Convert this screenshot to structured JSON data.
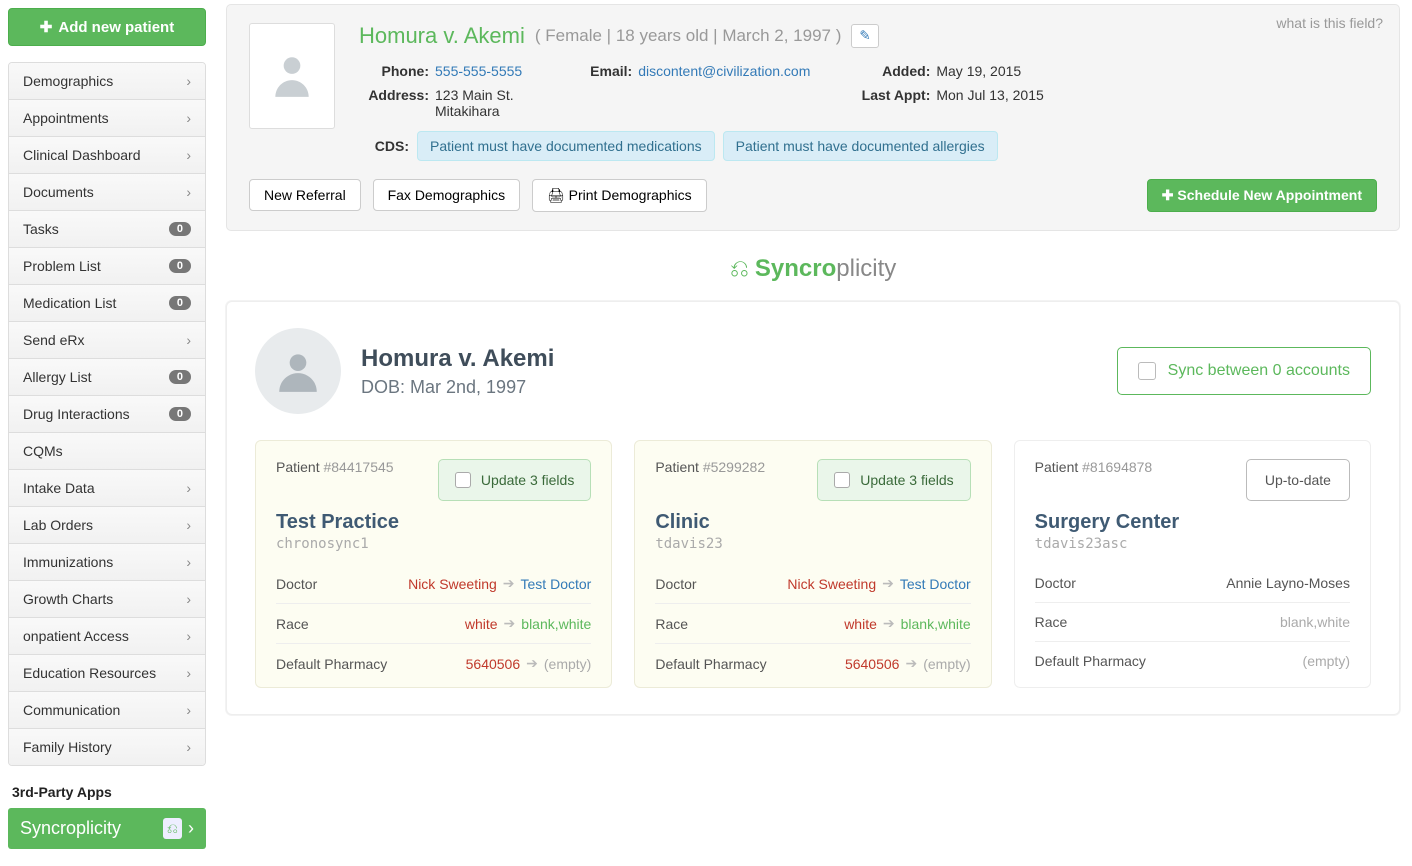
{
  "sidebar": {
    "add_patient": "Add new patient",
    "items": [
      {
        "label": "Demographics",
        "chevron": true
      },
      {
        "label": "Appointments",
        "chevron": true
      },
      {
        "label": "Clinical Dashboard",
        "chevron": true
      },
      {
        "label": "Documents",
        "chevron": true
      },
      {
        "label": "Tasks",
        "badge": "0"
      },
      {
        "label": "Problem List",
        "badge": "0"
      },
      {
        "label": "Medication List",
        "badge": "0"
      },
      {
        "label": "Send eRx",
        "chevron": true
      },
      {
        "label": "Allergy List",
        "badge": "0"
      },
      {
        "label": "Drug Interactions",
        "badge": "0"
      },
      {
        "label": "CQMs"
      },
      {
        "label": "Intake Data",
        "chevron": true
      },
      {
        "label": "Lab Orders",
        "chevron": true
      },
      {
        "label": "Immunizations",
        "chevron": true
      },
      {
        "label": "Growth Charts",
        "chevron": true
      },
      {
        "label": "onpatient Access",
        "chevron": true
      },
      {
        "label": "Education Resources",
        "chevron": true
      },
      {
        "label": "Communication",
        "chevron": true
      },
      {
        "label": "Family History",
        "chevron": true
      }
    ],
    "third_party_header": "3rd-Party Apps",
    "syncroplicity": "Syncroplicity"
  },
  "header": {
    "what_is_this": "what is this field?",
    "name": "Homura v. Akemi",
    "gender": "Female",
    "age": "18 years old",
    "dob": "March 2, 1997",
    "phone_label": "Phone:",
    "phone": "555-555-5555",
    "address_label": "Address:",
    "address_l1": "123 Main St.",
    "address_l2": "Mitakihara",
    "email_label": "Email:",
    "email": "discontent@civilization.com",
    "added_label": "Added:",
    "added": "May 19, 2015",
    "last_appt_label": "Last Appt:",
    "last_appt": "Mon Jul 13, 2015",
    "cds_label": "CDS:",
    "cds_tags": [
      "Patient must have documented medications",
      "Patient must have documented allergies"
    ],
    "btn_new_referral": "New Referral",
    "btn_fax": "Fax Demographics",
    "btn_print": "Print Demographics",
    "btn_schedule": "Schedule New Appointment"
  },
  "syncro": {
    "brand_a": "Syncro",
    "brand_b": "plicity",
    "name": "Homura v. Akemi",
    "dob_label": "DOB: Mar 2nd, 1997",
    "sync_between": "Sync between 0 accounts",
    "patient_label": "Patient",
    "update_label": "Update 3 fields",
    "uptodate_label": "Up-to-date",
    "cards": [
      {
        "id": "#84417545",
        "practice": "Test Practice",
        "user": "chronosync1",
        "highlight": true,
        "update": true,
        "rows": [
          {
            "name": "Doctor",
            "old": "Nick Sweeting",
            "new": "Test Doctor",
            "old_c": "v-red",
            "new_c": "v-blue"
          },
          {
            "name": "Race",
            "old": "white",
            "new": "blank,white",
            "old_c": "v-red",
            "new_c": "v-green"
          },
          {
            "name": "Default Pharmacy",
            "old": "5640506",
            "new": "(empty)",
            "old_c": "v-red",
            "new_c": "v-gray"
          }
        ]
      },
      {
        "id": "#5299282",
        "practice": "Clinic",
        "user": "tdavis23",
        "highlight": true,
        "update": true,
        "rows": [
          {
            "name": "Doctor",
            "old": "Nick Sweeting",
            "new": "Test Doctor",
            "old_c": "v-red",
            "new_c": "v-blue"
          },
          {
            "name": "Race",
            "old": "white",
            "new": "blank,white",
            "old_c": "v-red",
            "new_c": "v-green"
          },
          {
            "name": "Default Pharmacy",
            "old": "5640506",
            "new": "(empty)",
            "old_c": "v-red",
            "new_c": "v-gray"
          }
        ]
      },
      {
        "id": "#81694878",
        "practice": "Surgery Center",
        "user": "tdavis23asc",
        "highlight": false,
        "update": false,
        "rows": [
          {
            "name": "Doctor",
            "val": "Annie Layno-Moses"
          },
          {
            "name": "Race",
            "val": "blank,white"
          },
          {
            "name": "Default Pharmacy",
            "val": "(empty)"
          }
        ]
      }
    ]
  }
}
